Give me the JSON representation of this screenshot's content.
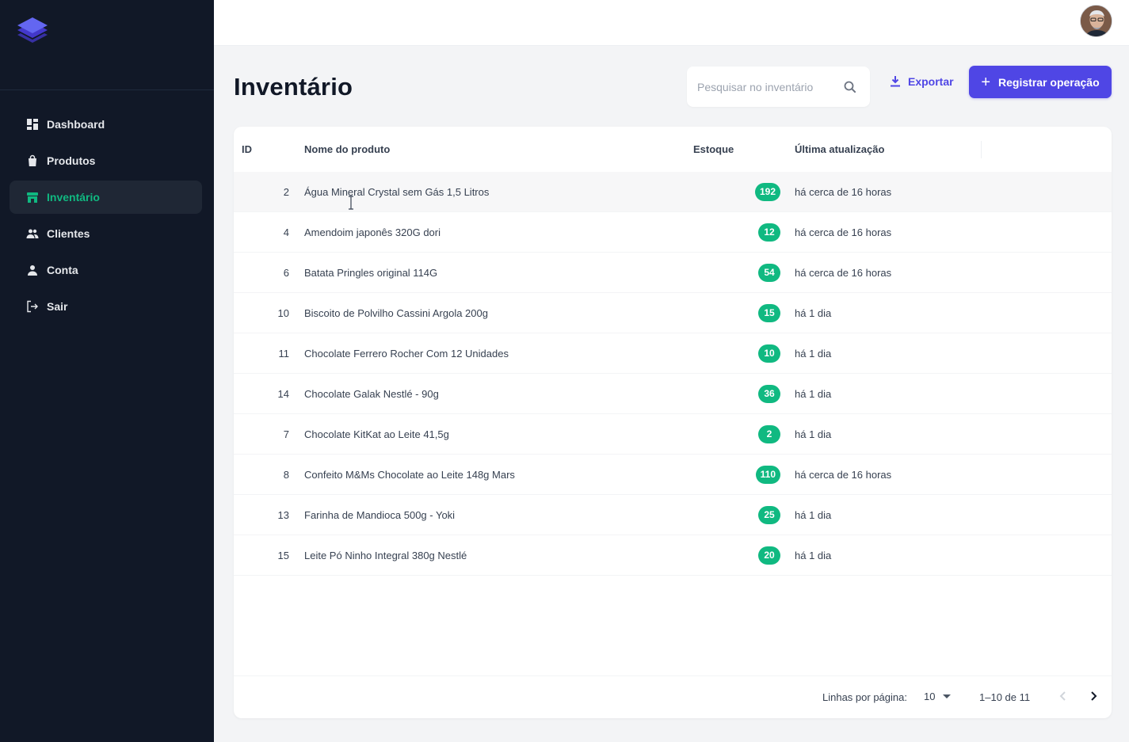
{
  "sidebar": {
    "items": [
      {
        "label": "Dashboard",
        "icon": "dashboard-icon",
        "active": false
      },
      {
        "label": "Produtos",
        "icon": "shopping-bag-icon",
        "active": false
      },
      {
        "label": "Inventário",
        "icon": "store-icon",
        "active": true
      },
      {
        "label": "Clientes",
        "icon": "users-icon",
        "active": false
      },
      {
        "label": "Conta",
        "icon": "user-icon",
        "active": false
      },
      {
        "label": "Sair",
        "icon": "logout-icon",
        "active": false
      }
    ]
  },
  "header": {
    "title": "Inventário",
    "search_placeholder": "Pesquisar no inventário",
    "export_label": "Exportar",
    "register_label": "Registrar operação"
  },
  "table": {
    "columns": {
      "id": "ID",
      "name": "Nome do produto",
      "stock": "Estoque",
      "updated": "Última atualização"
    },
    "rows": [
      {
        "id": "2",
        "name": "Água Mineral Crystal sem Gás 1,5 Litros",
        "stock": "192",
        "updated": "há cerca de 16 horas"
      },
      {
        "id": "4",
        "name": "Amendoim japonês 320G dori",
        "stock": "12",
        "updated": "há cerca de 16 horas"
      },
      {
        "id": "6",
        "name": "Batata Pringles original 114G",
        "stock": "54",
        "updated": "há cerca de 16 horas"
      },
      {
        "id": "10",
        "name": "Biscoito de Polvilho Cassini Argola 200g",
        "stock": "15",
        "updated": "há 1 dia"
      },
      {
        "id": "11",
        "name": "Chocolate Ferrero Rocher Com 12 Unidades",
        "stock": "10",
        "updated": "há 1 dia"
      },
      {
        "id": "14",
        "name": "Chocolate Galak Nestlé - 90g",
        "stock": "36",
        "updated": "há 1 dia"
      },
      {
        "id": "7",
        "name": "Chocolate KitKat ao Leite 41,5g",
        "stock": "2",
        "updated": "há 1 dia"
      },
      {
        "id": "8",
        "name": "Confeito M&Ms Chocolate ao Leite 148g Mars",
        "stock": "110",
        "updated": "há cerca de 16 horas"
      },
      {
        "id": "13",
        "name": "Farinha de Mandioca 500g - Yoki",
        "stock": "25",
        "updated": "há 1 dia"
      },
      {
        "id": "15",
        "name": "Leite Pó Ninho Integral 380g Nestlé",
        "stock": "20",
        "updated": "há 1 dia"
      }
    ]
  },
  "pagination": {
    "rows_per_page_label": "Linhas por página:",
    "rows_per_page_value": "10",
    "range": "1–10 de 11"
  },
  "colors": {
    "sidebar_bg": "#111827",
    "accent": "#4f46e5",
    "active_nav": "#10b981",
    "badge": "#10b981"
  }
}
